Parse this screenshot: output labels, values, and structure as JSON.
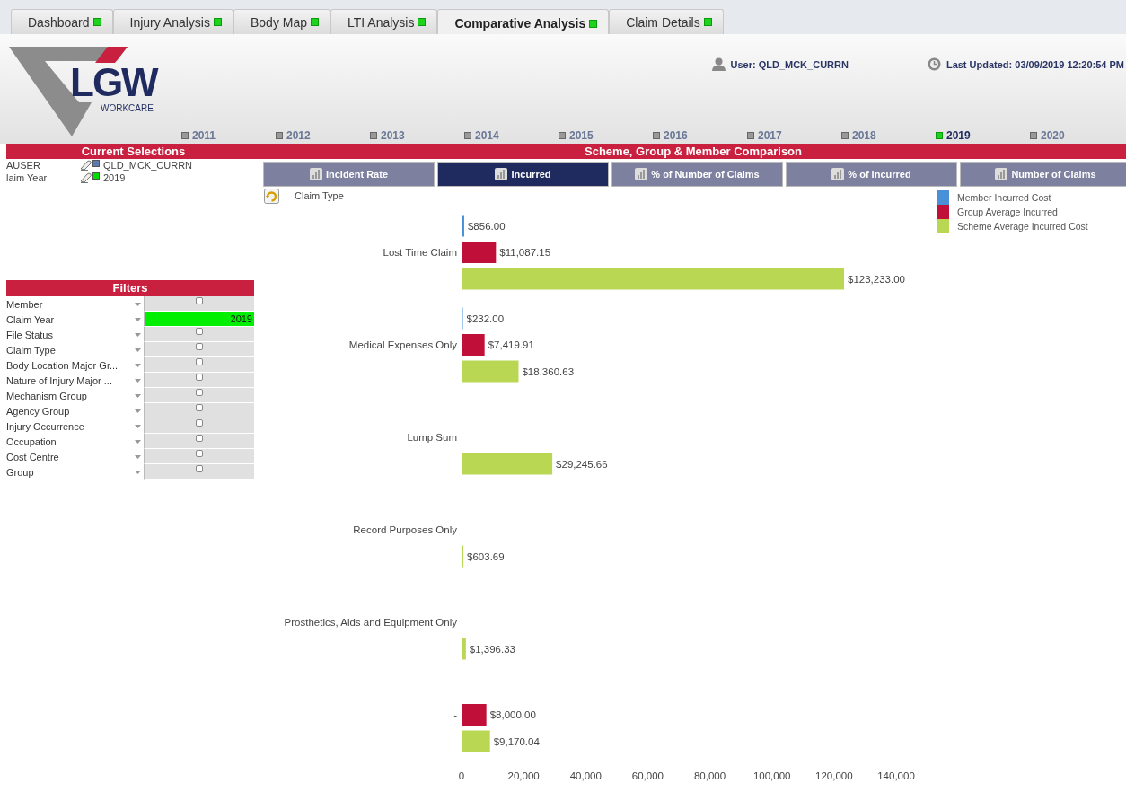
{
  "tabs": [
    {
      "label": "Dashboard",
      "selected": false
    },
    {
      "label": "Injury Analysis",
      "selected": false
    },
    {
      "label": "Body Map",
      "selected": false
    },
    {
      "label": "LTI Analysis",
      "selected": false
    },
    {
      "label": "Comparative Analysis",
      "selected": true
    },
    {
      "label": "Claim Details",
      "selected": false
    }
  ],
  "header": {
    "logo": {
      "name": "LGW",
      "tagline": "WORKCARE"
    },
    "user": "User: QLD_MCK_CURRN",
    "last_updated": "Last Updated: 03/09/2019 12:20:54 PM",
    "years": [
      {
        "label": "2011",
        "selected": false
      },
      {
        "label": "2012",
        "selected": false
      },
      {
        "label": "2013",
        "selected": false
      },
      {
        "label": "2014",
        "selected": false
      },
      {
        "label": "2015",
        "selected": false
      },
      {
        "label": "2016",
        "selected": false
      },
      {
        "label": "2017",
        "selected": false
      },
      {
        "label": "2018",
        "selected": false
      },
      {
        "label": "2019",
        "selected": true
      },
      {
        "label": "2020",
        "selected": false
      }
    ]
  },
  "current_selections": {
    "title": "Current Selections",
    "rows": [
      {
        "field": "AUSER",
        "value": "QLD_MCK_CURRN",
        "color": "#5b7bb0"
      },
      {
        "field": "laim Year",
        "value": "2019",
        "color": "#00dd00"
      }
    ]
  },
  "filters": {
    "title": "Filters",
    "rows": [
      {
        "label": "Member",
        "selected": false
      },
      {
        "label": "Claim Year",
        "selected": true,
        "value": "2019"
      },
      {
        "label": "File Status",
        "selected": false
      },
      {
        "label": "Claim Type",
        "selected": false
      },
      {
        "label": "Body Location Major Gr...",
        "selected": false
      },
      {
        "label": "Nature of Injury Major ...",
        "selected": false
      },
      {
        "label": "Mechanism Group",
        "selected": false
      },
      {
        "label": "Agency Group",
        "selected": false
      },
      {
        "label": "Injury Occurrence",
        "selected": false
      },
      {
        "label": "Occupation",
        "selected": false
      },
      {
        "label": "Cost Centre",
        "selected": false
      },
      {
        "label": "Group",
        "selected": false
      }
    ]
  },
  "comparison": {
    "title": "Scheme, Group & Member Comparison",
    "chart_tabs": [
      {
        "label": "Incident Rate",
        "selected": false
      },
      {
        "label": "Incurred",
        "selected": true
      },
      {
        "label": "% of Number of Claims",
        "selected": false
      },
      {
        "label": "% of Incurred",
        "selected": false
      },
      {
        "label": "Number of Claims",
        "selected": false
      }
    ],
    "chart_data": {
      "type": "bar",
      "orientation": "horizontal",
      "ylabel": "Claim Type",
      "categories": [
        "Lost Time Claim",
        "Medical Expenses Only",
        "Lump Sum",
        "Record Purposes Only",
        "Prosthetics, Aids and Equipment Only",
        "-"
      ],
      "series": [
        {
          "name": "Member Incurred Cost",
          "color": "#4a90d9",
          "values": [
            856,
            232,
            null,
            null,
            null,
            null
          ]
        },
        {
          "name": "Group Average Incurred",
          "color": "#c0103a",
          "values": [
            11087.15,
            7419.91,
            null,
            null,
            null,
            8000
          ]
        },
        {
          "name": "Scheme Average Incurred Cost",
          "color": "#b9d752",
          "values": [
            123233,
            18360.63,
            29245.66,
            603.69,
            1396.33,
            9170.04
          ]
        }
      ],
      "value_labels": [
        [
          "$856.00",
          "$232.00",
          null,
          null,
          null,
          null
        ],
        [
          "$11,087.15",
          "$7,419.91",
          null,
          null,
          null,
          "$8,000.00"
        ],
        [
          "$123,233.00",
          "$18,360.63",
          "$29,245.66",
          "$603.69",
          "$1,396.33",
          "$9,170.04"
        ]
      ],
      "xlim": [
        0,
        140000
      ],
      "legend": "top-right",
      "xticks": [
        {
          "value": 0,
          "label": "0"
        },
        {
          "value": 20000,
          "label": "20,000"
        },
        {
          "value": 40000,
          "label": "40,000"
        },
        {
          "value": 60000,
          "label": "60,000"
        },
        {
          "value": 80000,
          "label": "80,000"
        },
        {
          "value": 100000,
          "label": "100,000"
        },
        {
          "value": 120000,
          "label": "120,000"
        },
        {
          "value": 140000,
          "label": "140,000"
        }
      ]
    }
  }
}
